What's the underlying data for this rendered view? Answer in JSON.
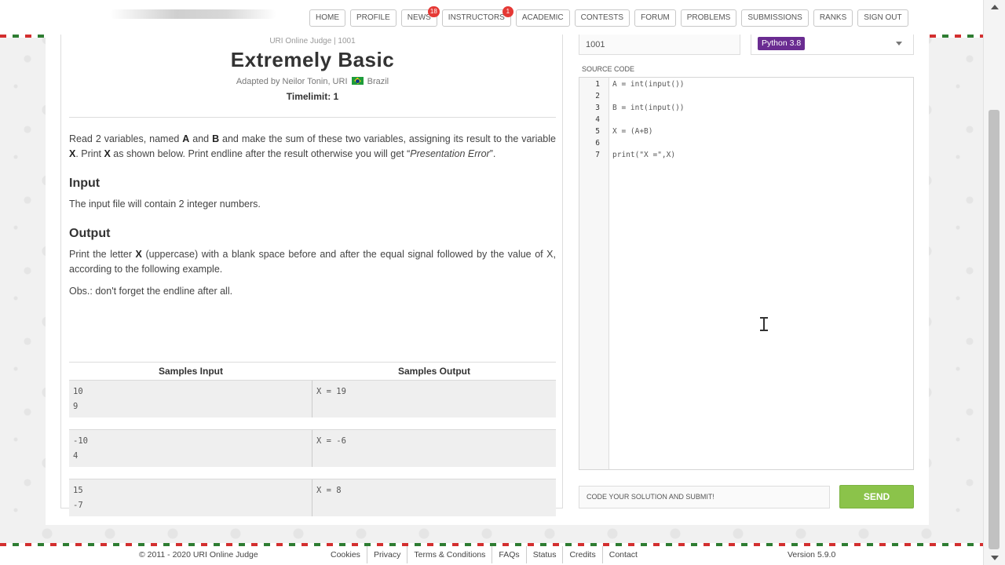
{
  "nav": {
    "items": [
      {
        "label": "HOME"
      },
      {
        "label": "PROFILE"
      },
      {
        "label": "NEWS",
        "badge": "18"
      },
      {
        "label": "INSTRUCTORS",
        "badge": "1"
      },
      {
        "label": "ACADEMIC"
      },
      {
        "label": "CONTESTS"
      },
      {
        "label": "FORUM"
      },
      {
        "label": "PROBLEMS"
      },
      {
        "label": "SUBMISSIONS"
      },
      {
        "label": "RANKS"
      },
      {
        "label": "SIGN OUT"
      }
    ]
  },
  "problem": {
    "judge_line": "URI Online Judge | 1001",
    "title": "Extremely Basic",
    "adapted_prefix": "Adapted by Neilor Tonin, URI",
    "adapted_country": "Brazil",
    "timelimit": "Timelimit: 1",
    "description": {
      "p1": "Read 2 variables, named ",
      "a": "A",
      "p2": " and ",
      "b": "B",
      "p3": " and make the sum of these two variables, assigning its result to the variable ",
      "x1": "X",
      "p4": ". Print ",
      "x2": "X",
      "p5": " as shown below. Print endline after the result otherwise you will get “",
      "em": "Presentation Error",
      "p6": "”."
    },
    "input_title": "Input",
    "input_text": "The input file will contain 2 integer numbers.",
    "output_title": "Output",
    "output": {
      "p1": "Print the letter ",
      "x": "X",
      "p2": " (uppercase) with a blank space before and after the equal signal followed by the value of X, according to the following example."
    },
    "obs": "Obs.: don't forget the endline after all.",
    "samples_input_header": "Samples Input",
    "samples_output_header": "Samples Output",
    "samples": [
      {
        "input": "10\n9",
        "output": "X = 19"
      },
      {
        "input": "-10\n4",
        "output": "X = -6"
      },
      {
        "input": "15\n-7",
        "output": "X = 8"
      }
    ]
  },
  "editor": {
    "problem_id": "1001",
    "language": "Python 3.8",
    "source_label": "SOURCE CODE",
    "line_numbers": [
      "1",
      "2",
      "3",
      "4",
      "5",
      "6",
      "7"
    ],
    "code_lines": [
      "A = int(input())",
      "",
      "B = int(input())",
      "",
      "X = (A+B)",
      "",
      "print(\"X =\",X)"
    ],
    "submit_placeholder": "CODE YOUR SOLUTION AND SUBMIT!",
    "send_label": "SEND"
  },
  "footer": {
    "copyright": "© 2011 - 2020 URI Online Judge",
    "links": [
      "Cookies",
      "Privacy",
      "Terms & Conditions",
      "FAQs",
      "Status",
      "Credits",
      "Contact"
    ],
    "version": "Version 5.9.0"
  },
  "colors": {
    "send_button": "#8bc34a",
    "language_tag": "#6a2c91",
    "badge": "#e53935"
  }
}
